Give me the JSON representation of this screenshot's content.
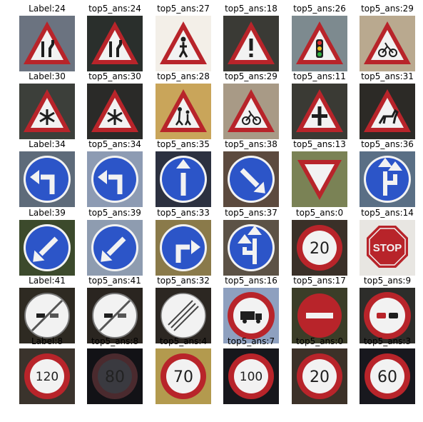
{
  "figure": {
    "rows": [
      {
        "cells": [
          {
            "title": "Label:24",
            "sign": "narrows-right-icon",
            "bg": "#6b7380"
          },
          {
            "title": "top5_ans:24",
            "sign": "narrows-right-icon",
            "bg": "#2a2f2c"
          },
          {
            "title": "top5_ans:27",
            "sign": "pedestrians-icon",
            "bg": "#f3efe8"
          },
          {
            "title": "top5_ans:18",
            "sign": "general-caution-icon",
            "bg": "#3a3a35"
          },
          {
            "title": "top5_ans:26",
            "sign": "traffic-signals-icon",
            "bg": "#7d8a8f"
          },
          {
            "title": "top5_ans:29",
            "sign": "bicycles-crossing-icon",
            "bg": "#b9a98f"
          }
        ]
      },
      {
        "cells": [
          {
            "title": "Label:30",
            "sign": "ice-snow-icon",
            "bg": "#3c3f3a"
          },
          {
            "title": "top5_ans:30",
            "sign": "ice-snow-icon",
            "bg": "#2a2a28"
          },
          {
            "title": "top5_ans:28",
            "sign": "children-crossing-icon",
            "bg": "#c9a55a"
          },
          {
            "title": "top5_ans:29",
            "sign": "bicycles-crossing-icon",
            "bg": "#a89a86"
          },
          {
            "title": "top5_ans:11",
            "sign": "right-of-way-icon",
            "bg": "#3a3a34"
          },
          {
            "title": "top5_ans:31",
            "sign": "wild-animals-icon",
            "bg": "#2c2a26"
          }
        ]
      },
      {
        "cells": [
          {
            "title": "Label:34",
            "sign": "turn-left-ahead-icon",
            "bg": "#5e6b7a"
          },
          {
            "title": "top5_ans:34",
            "sign": "turn-left-ahead-icon",
            "bg": "#8d9bb3"
          },
          {
            "title": "top5_ans:35",
            "sign": "ahead-only-icon",
            "bg": "#2c3140"
          },
          {
            "title": "top5_ans:38",
            "sign": "keep-right-icon",
            "bg": "#5c4a3e"
          },
          {
            "title": "top5_ans:13",
            "sign": "yield-icon",
            "bg": "#7a8255"
          },
          {
            "title": "top5_ans:36",
            "sign": "go-straight-right-icon",
            "bg": "#5a6f85"
          }
        ]
      },
      {
        "cells": [
          {
            "title": "Label:39",
            "sign": "keep-left-icon",
            "bg": "#3c4a2c"
          },
          {
            "title": "top5_ans:39",
            "sign": "keep-left-icon",
            "bg": "#8e9cb0"
          },
          {
            "title": "top5_ans:33",
            "sign": "turn-right-ahead-icon",
            "bg": "#8a7a4a"
          },
          {
            "title": "top5_ans:37",
            "sign": "go-straight-left-icon",
            "bg": "#5c5246"
          },
          {
            "title": "top5_ans:0",
            "sign": "speed-limit-20-icon",
            "bg": "#3a3028"
          },
          {
            "title": "top5_ans:14",
            "sign": "stop-icon",
            "bg": "#e8e6e2"
          }
        ]
      },
      {
        "cells": [
          {
            "title": "Label:41",
            "sign": "end-no-passing-icon",
            "bg": "#2e2a22"
          },
          {
            "title": "top5_ans:41",
            "sign": "end-no-passing-icon",
            "bg": "#2a2520"
          },
          {
            "title": "top5_ans:32",
            "sign": "end-all-limits-icon",
            "bg": "#2c2722"
          },
          {
            "title": "top5_ans:16",
            "sign": "no-trucks-icon",
            "bg": "#8ea0bf"
          },
          {
            "title": "top5_ans:17",
            "sign": "no-entry-icon",
            "bg": "#3b3d28"
          },
          {
            "title": "top5_ans:9",
            "sign": "no-passing-icon",
            "bg": "#2d2d2a"
          }
        ]
      },
      {
        "cells": [
          {
            "title": "Label:8",
            "sign": "speed-limit-120-icon",
            "bg": "#3a332c"
          },
          {
            "title": "top5_ans:8",
            "sign": "speed-limit-dark-icon",
            "bg": "#121216"
          },
          {
            "title": "top5_ans:4",
            "sign": "speed-limit-70-icon",
            "bg": "#b39a4e"
          },
          {
            "title": "top5_ans:7",
            "sign": "speed-limit-100-icon",
            "bg": "#17171c"
          },
          {
            "title": "top5_ans:0",
            "sign": "speed-limit-20-icon",
            "bg": "#3c3128"
          },
          {
            "title": "top5_ans:3",
            "sign": "speed-limit-60-icon",
            "bg": "#18181e"
          }
        ]
      }
    ],
    "colors": {
      "red": "#b8242a",
      "blue": "#2c55c8",
      "white": "#f2f2f2",
      "black": "#1e1e1e"
    }
  }
}
